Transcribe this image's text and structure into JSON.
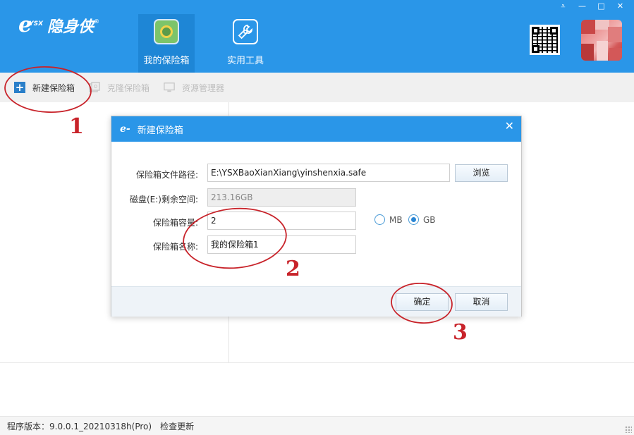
{
  "app": {
    "brand_e": "e",
    "brand_ysx": "YSX",
    "brand_name": "隐身侠",
    "brand_reg": "®"
  },
  "window_controls": {
    "dropdown": "⩡",
    "minimize": "—",
    "maximize": "□",
    "close": "✕"
  },
  "nav": {
    "tabs": [
      {
        "label": "我的保险箱",
        "icon": "safe-icon",
        "active": true
      },
      {
        "label": "实用工具",
        "icon": "tools-icon",
        "active": false
      }
    ]
  },
  "toolbar": {
    "new_safe": "新建保险箱",
    "clone_safe": "克隆保险箱",
    "resource_manager": "资源管理器"
  },
  "dialog": {
    "title": "新建保险箱",
    "close": "✕",
    "path_label": "保险箱文件路径:",
    "path_value": "E:\\YSXBaoXianXiang\\yinshenxia.safe",
    "browse_label": "浏览",
    "disk_label": "磁盘(E:)剩余空间:",
    "disk_value": "213.16GB",
    "capacity_label": "保险箱容量:",
    "capacity_value": "2",
    "unit_mb": "MB",
    "unit_gb": "GB",
    "unit_selected": "GB",
    "name_label": "保险箱名称:",
    "name_value": "我的保险箱1",
    "ok_label": "确定",
    "cancel_label": "取消"
  },
  "status": {
    "version": "程序版本：9.0.0.1_20210318h(Pro)",
    "check_update": "检查更新"
  },
  "annotations": {
    "step1": "1",
    "step2": "2",
    "step3": "3",
    "color": "#c8232a"
  },
  "colors": {
    "header_blue": "#2a96e8",
    "active_tab": "#1e86d6",
    "toolbar_bg": "#f0f0f0",
    "annotation_red": "#c8232a"
  }
}
